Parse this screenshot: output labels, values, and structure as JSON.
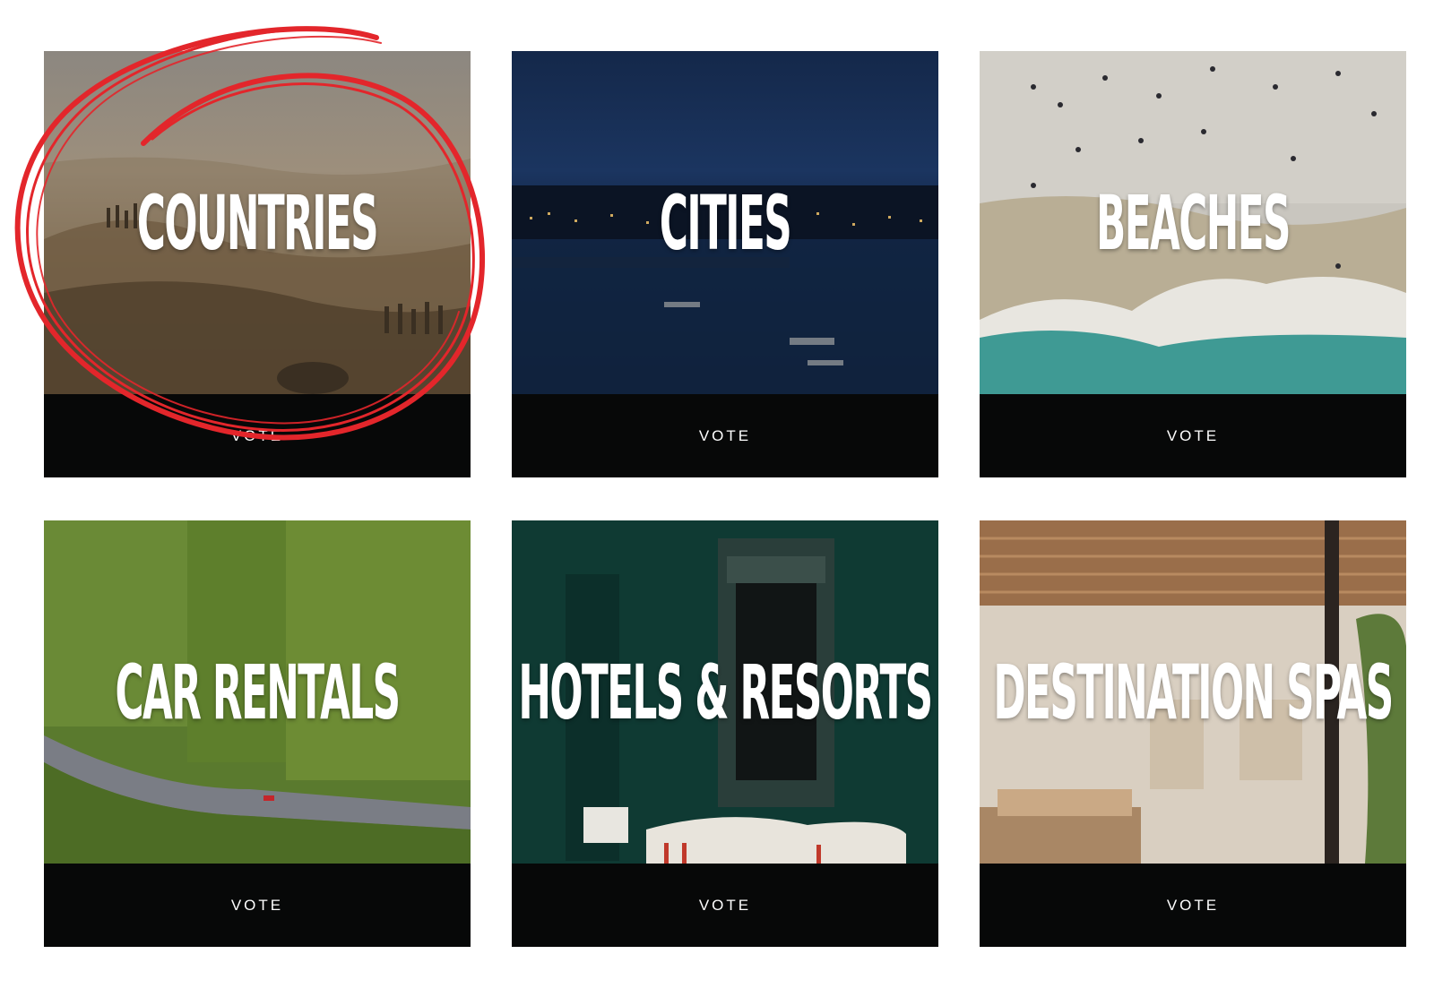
{
  "categories": [
    {
      "title": "COUNTRIES",
      "vote_label": "VOTE",
      "image": "misty-tuscan-hills"
    },
    {
      "title": "CITIES",
      "vote_label": "VOTE",
      "image": "night-harbor-city"
    },
    {
      "title": "BEACHES",
      "vote_label": "VOTE",
      "image": "aerial-beach-waves"
    },
    {
      "title": "CAR RENTALS",
      "vote_label": "VOTE",
      "image": "aerial-road-fields"
    },
    {
      "title": "HOTELS & RESORTS",
      "vote_label": "VOTE",
      "image": "green-hotel-room-mirror"
    },
    {
      "title": "DESTINATION SPAS",
      "vote_label": "VOTE",
      "image": "sunlit-spa-interior"
    }
  ],
  "colors": {
    "vote_bar": "#070808",
    "title_text": "#ffffff",
    "highlight_ring": "#e3262b"
  }
}
